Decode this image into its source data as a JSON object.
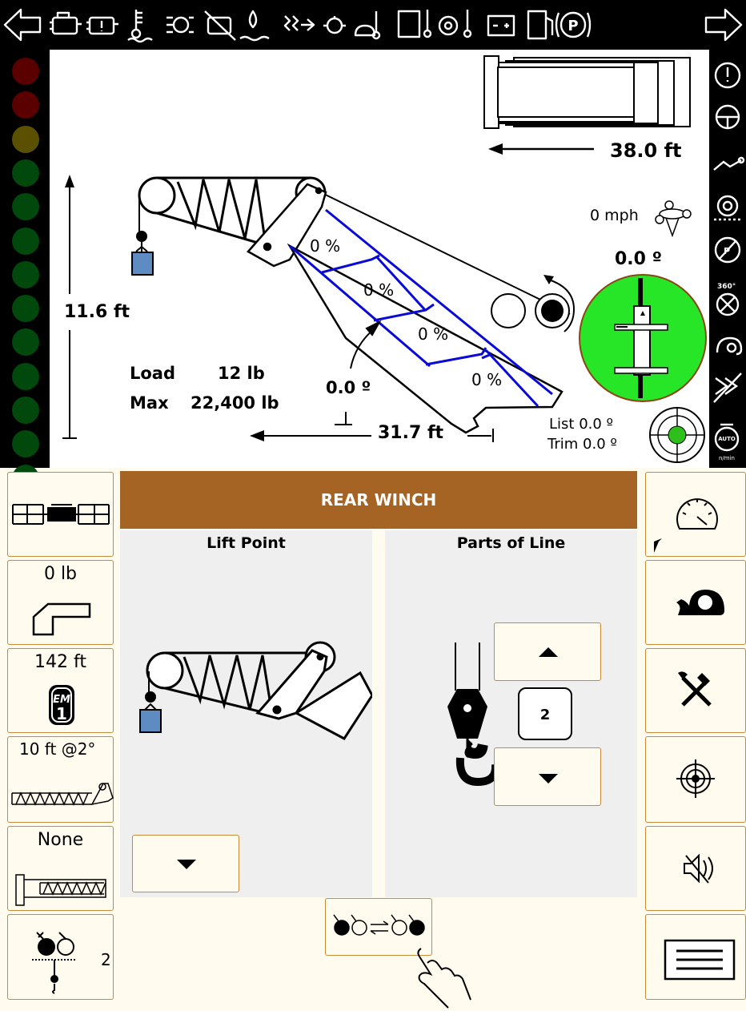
{
  "status_icons": [
    "left-arrow",
    "engine",
    "engine-warning",
    "coolant-temp",
    "transmission",
    "engine-off",
    "water-in-fuel",
    "intake-heater",
    "oil-pressure",
    "oil-temp",
    "hydraulic-temp",
    "transmission-temp",
    "battery",
    "fuel",
    "park-brake",
    "right-arrow"
  ],
  "right_strip_icons": [
    "alert",
    "steering",
    "boom-hook",
    "gear-warning",
    "park-brake-off",
    "360-swing-disabled",
    "creep-speed",
    "function-lockout",
    "auto-idle"
  ],
  "right_strip_auto_label": "AUTO",
  "right_strip_unit": "n/min",
  "lamp_colors": [
    "#5a0000",
    "#5a0000",
    "#5a5000",
    "#00480b",
    "#00480b",
    "#00480b",
    "#00480b",
    "#00480b",
    "#00480b",
    "#00480b",
    "#00480b",
    "#00480b",
    "#00480b"
  ],
  "diagram": {
    "radius_top": "38.0 ft",
    "height": "11.6  ft",
    "radius_bottom": "31.7  ft",
    "wind_speed": "0  mph",
    "slew_angle": "0.0 º",
    "boom_angle": "0.0 º",
    "load_label": "Load",
    "load_value": "12  lb",
    "max_label": "Max",
    "max_value": "22,400  lb",
    "list_label": "List",
    "list_value": "0.0 º",
    "trim_label": "Trim",
    "trim_value": "0.0 º",
    "sections": [
      "0 %",
      "0 %",
      "0 %",
      "0 %"
    ]
  },
  "left_buttons": {
    "outriggers": "",
    "load_value": "0 lb",
    "em_value": "142 ft",
    "jib_value": "10 ft @2°",
    "insert_value": "None",
    "parts_value": "2"
  },
  "main": {
    "header": "REAR WINCH",
    "lift_point_title": "Lift Point",
    "parts_title": "Parts of Line",
    "parts_count": "2"
  },
  "colors": {
    "accent": "#a66424",
    "button_border": "#c88a3c",
    "boom_section": "#0a0ad8",
    "level_green": "#27e627"
  }
}
